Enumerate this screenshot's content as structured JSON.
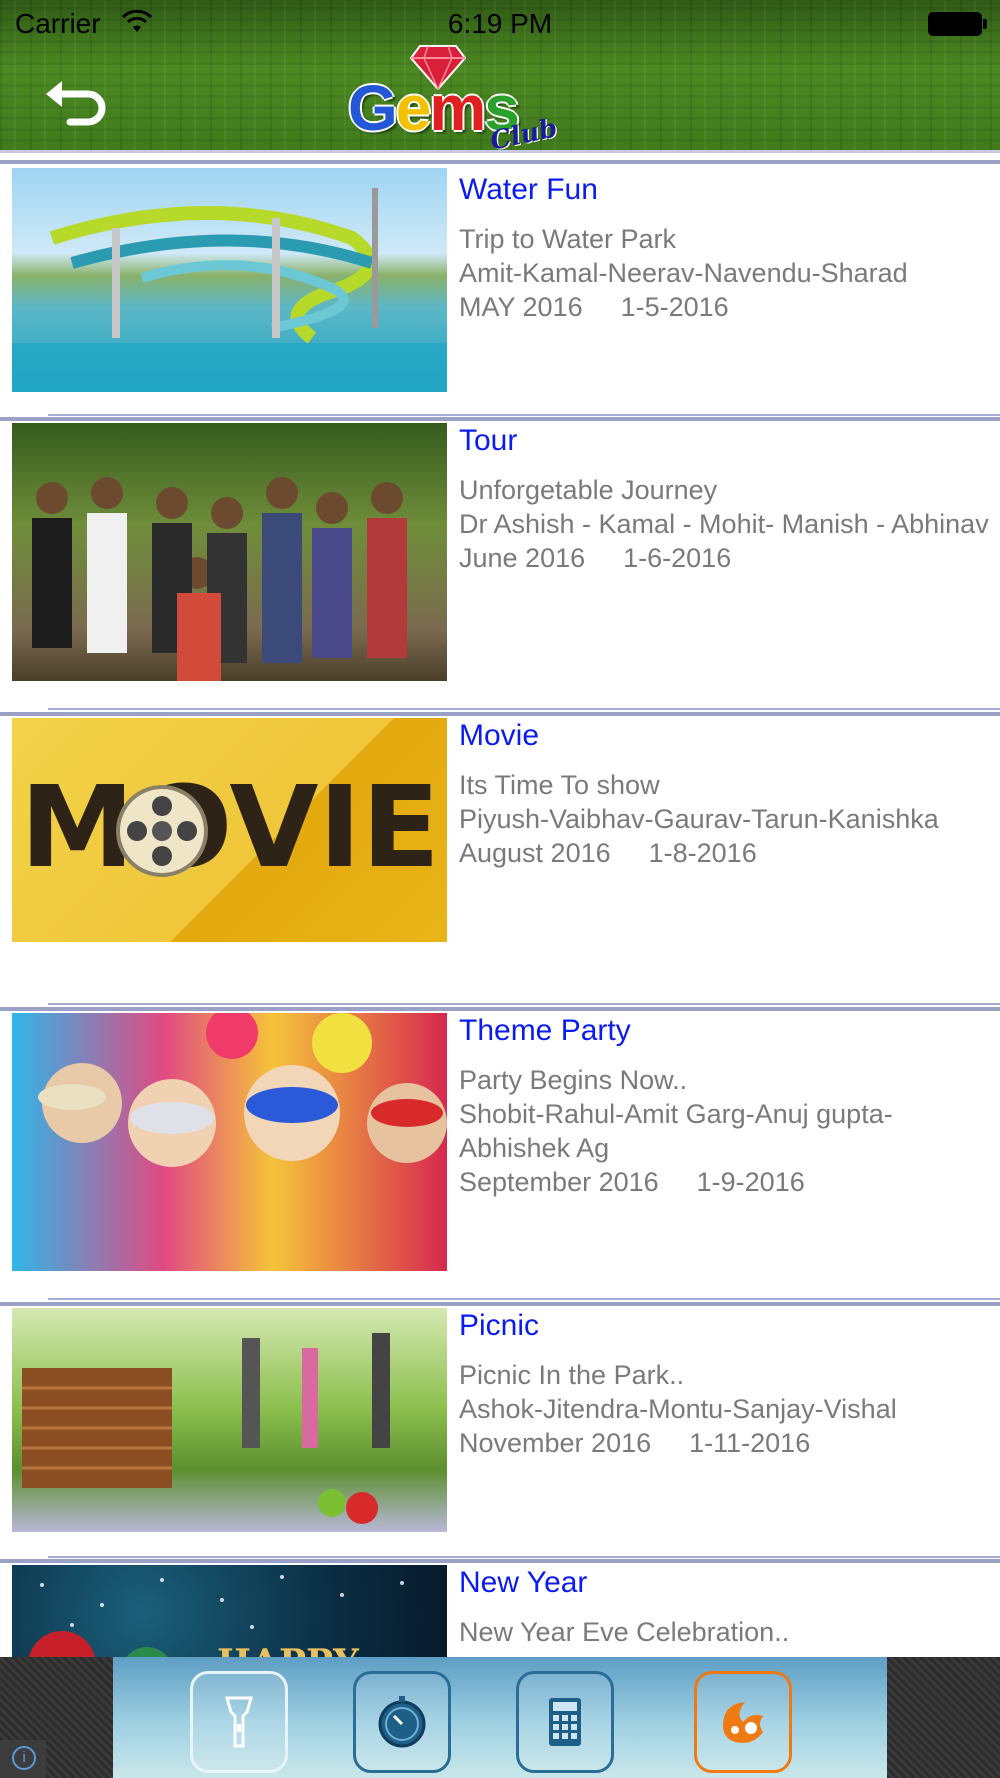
{
  "status_bar": {
    "carrier": "Carrier",
    "time": "6:19 PM"
  },
  "header": {
    "logo": {
      "word_letters": [
        "G",
        "e",
        "m",
        "s"
      ],
      "sub": "Club"
    }
  },
  "events": [
    {
      "title": "Water Fun",
      "subtitle": "Trip to Water Park",
      "members": "Amit-Kamal-Neerav-Navendu-Sharad",
      "month": "MAY 2016",
      "date": "1-5-2016"
    },
    {
      "title": "Tour",
      "subtitle": "Unforgetable Journey",
      "members": "Dr Ashish - Kamal - Mohit- Manish - Abhinav",
      "month": "June 2016",
      "date": "1-6-2016"
    },
    {
      "title": "Movie",
      "subtitle": "Its Time To show",
      "members": "Piyush-Vaibhav-Gaurav-Tarun-Kanishka",
      "month": "August 2016",
      "date": "1-8-2016",
      "thumb_text": "MOVIE"
    },
    {
      "title": "Theme Party",
      "subtitle": "Party Begins Now..",
      "members": "Shobit-Rahul-Amit Garg-Anuj gupta-Abhishek Ag",
      "month": "September 2016",
      "date": "1-9-2016"
    },
    {
      "title": "Picnic",
      "subtitle": "Picnic In the Park..",
      "members": "Ashok-Jitendra-Montu-Sanjay-Vishal",
      "month": "November 2016",
      "date": "1-11-2016"
    },
    {
      "title": "New Year",
      "subtitle": "New Year Eve Celebration..",
      "thumb_text": "HAPPY"
    }
  ],
  "toolbar": {
    "icons": [
      "flashlight-icon",
      "timer-icon",
      "calculator-icon",
      "uc-browser-icon"
    ],
    "info_glyph": "i"
  },
  "colors": {
    "title_blue": "#0a1cf0",
    "detail_gray": "#7a7a7a",
    "separator": "#a6acd6",
    "header_green": "#3f7a1c",
    "uc_orange": "#f07a12"
  }
}
